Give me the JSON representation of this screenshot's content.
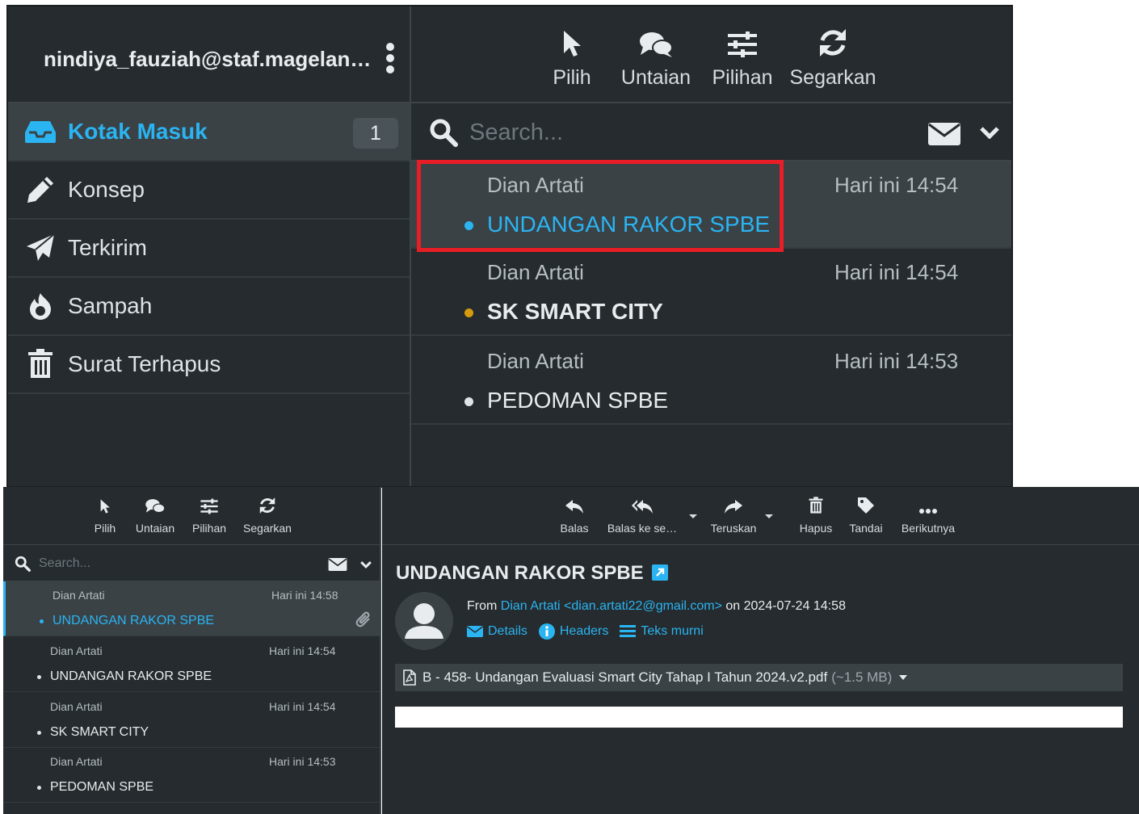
{
  "account": {
    "email": "nindiya_fauziah@staf.magelan…"
  },
  "toolbar": {
    "select": "Pilih",
    "threads": "Untaian",
    "options": "Pilihan",
    "refresh": "Segarkan"
  },
  "folders": [
    {
      "label": "Kotak Masuk",
      "icon": "inbox-icon",
      "badge": "1"
    },
    {
      "label": "Konsep",
      "icon": "pencil-icon"
    },
    {
      "label": "Terkirim",
      "icon": "paper-plane-icon"
    },
    {
      "label": "Sampah",
      "icon": "fire-icon"
    },
    {
      "label": "Surat Terhapus",
      "icon": "trash-icon"
    }
  ],
  "search": {
    "placeholder": "Search..."
  },
  "top_messages": [
    {
      "from": "Dian Artati",
      "time": "Hari ini 14:54",
      "subject": "UNDANGAN RAKOR SPBE"
    },
    {
      "from": "Dian Artati",
      "time": "Hari ini 14:54",
      "subject": "SK SMART CITY"
    },
    {
      "from": "Dian Artati",
      "time": "Hari ini 14:53",
      "subject": "PEDOMAN SPBE"
    }
  ],
  "bottom_messages": [
    {
      "from": "Dian Artati",
      "time": "Hari ini 14:58",
      "subject": "UNDANGAN RAKOR SPBE"
    },
    {
      "from": "Dian Artati",
      "time": "Hari ini 14:54",
      "subject": "UNDANGAN RAKOR SPBE"
    },
    {
      "from": "Dian Artati",
      "time": "Hari ini 14:54",
      "subject": "SK SMART CITY"
    },
    {
      "from": "Dian Artati",
      "time": "Hari ini 14:53",
      "subject": "PEDOMAN SPBE"
    }
  ],
  "reader_toolbar": {
    "reply": "Balas",
    "reply_all": "Balas ke se…",
    "forward": "Teruskan",
    "delete": "Hapus",
    "mark": "Tandai",
    "more": "Berikutnya"
  },
  "message": {
    "subject": "UNDANGAN RAKOR SPBE",
    "from_prefix": "From",
    "from": "Dian Artati <dian.artati22@gmail.com>",
    "date_text": "on 2024-07-24 14:58",
    "details": "Details",
    "headers": "Headers",
    "plain": "Teks murni",
    "attachment_name": "B - 458- Undangan Evaluasi Smart City Tahap I Tahun 2024.v2.pdf",
    "attachment_size": "(~1.5 MB)"
  },
  "colors": {
    "accent": "#2bb4f2",
    "background": "#252b2e",
    "highlight_box": "#e81d25",
    "flag_dot": "#d59a0e"
  }
}
